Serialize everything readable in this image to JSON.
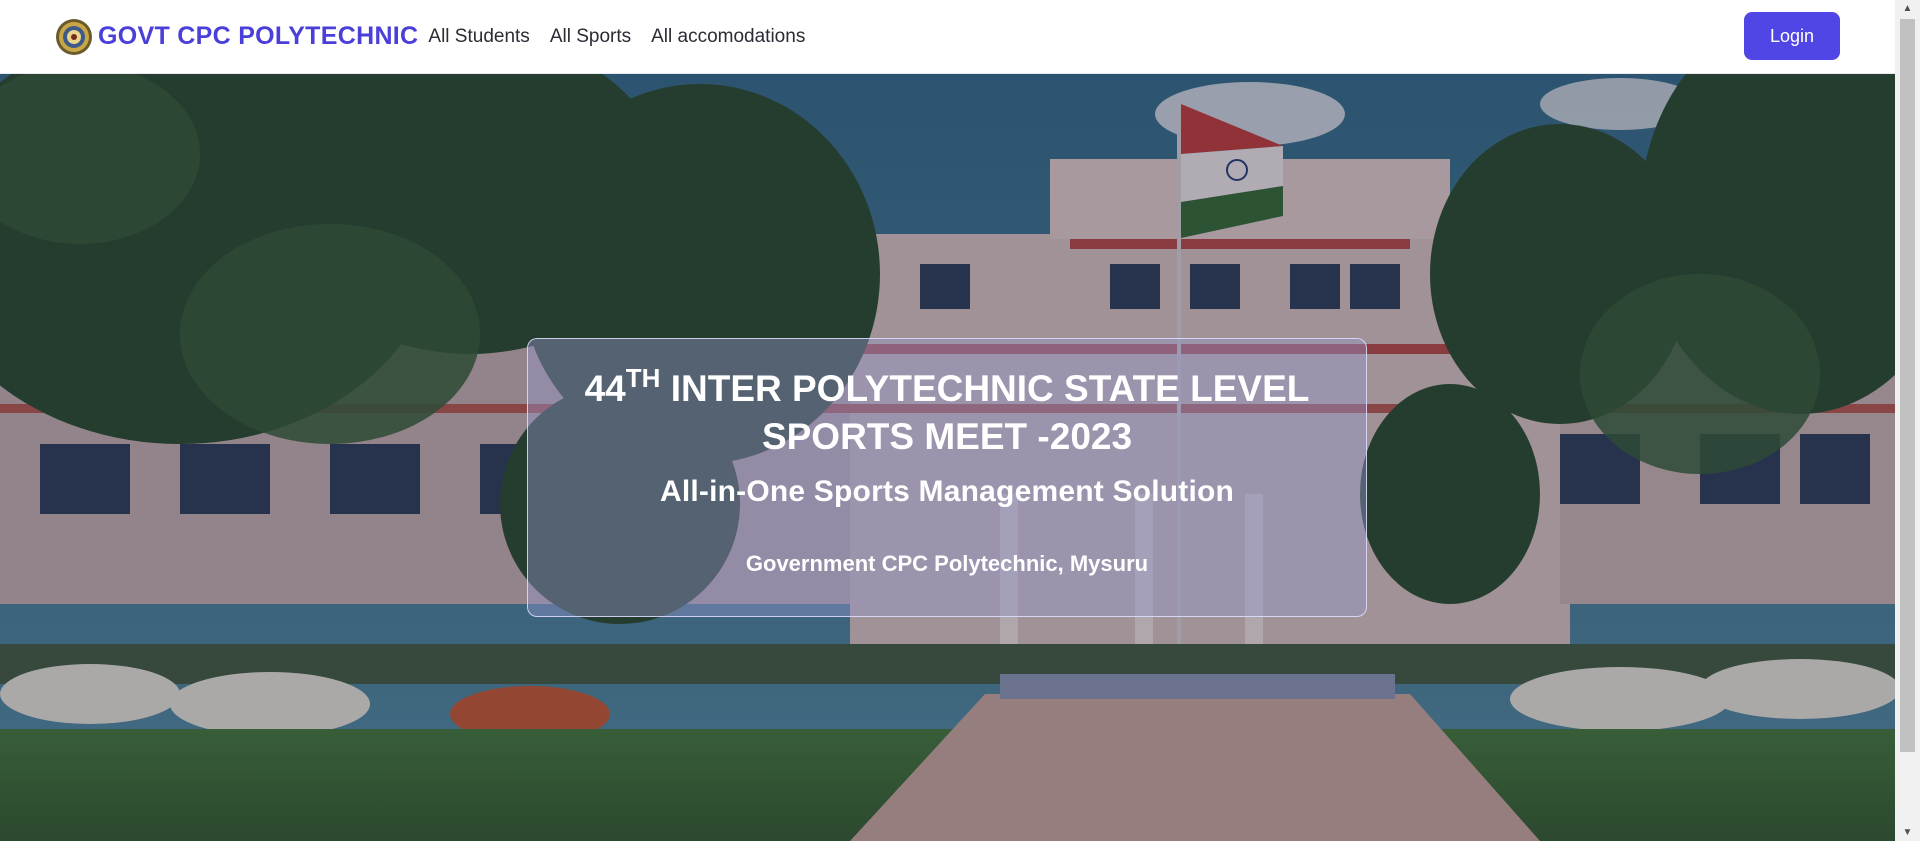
{
  "navbar": {
    "brand_name": "GOVT CPC POLYTECHNIC",
    "links": [
      {
        "label": "All Students"
      },
      {
        "label": "All Sports"
      },
      {
        "label": "All accomodations"
      }
    ],
    "login_label": "Login"
  },
  "hero": {
    "title_number": "44",
    "title_suffix": "TH",
    "title_line1": "INTER POLYTECHNIC STATE LEVEL",
    "title_line2": "SPORTS MEET -2023",
    "subtitle": "All-in-One Sports Management Solution",
    "location": "Government CPC Polytechnic, Mysuru"
  },
  "colors": {
    "brand": "#4a3fd8",
    "button": "#4f46e5",
    "card_overlay": "rgba(150,150,205,0.42)"
  },
  "icons": {
    "logo": "college-emblem-icon",
    "scroll_up": "triangle-up-icon",
    "scroll_down": "triangle-down-icon"
  }
}
